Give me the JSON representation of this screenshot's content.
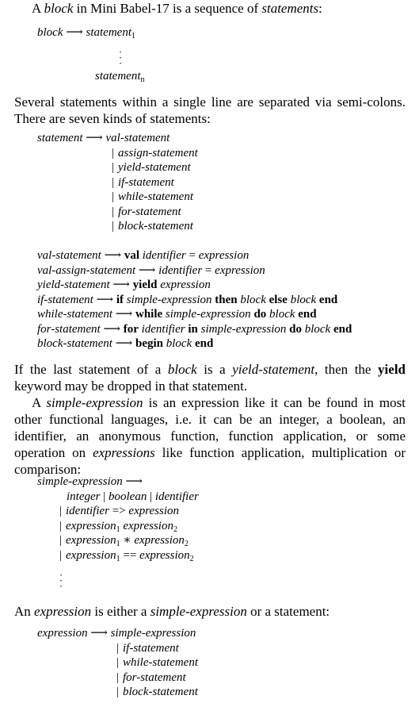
{
  "p1": {
    "a": "A ",
    "b": "block",
    "c": " in Mini Babel-17 is a sequence of ",
    "d": "statements",
    "e": ":"
  },
  "block_rule": {
    "lhs": "block",
    "arrow": "⟶",
    "first": "statement",
    "first_sub": "1",
    "last": "statement",
    "last_sub": "n"
  },
  "p2": "Several statements within a single line are separated via semi-colons. There are seven kinds of statements:",
  "stmt_rule": {
    "lhs": "statement",
    "arrow": "⟶",
    "alts": [
      "val-statement",
      "assign-statement",
      "yield-statement",
      "if-statement",
      "while-statement",
      "for-statement",
      "block-statement"
    ]
  },
  "rules": [
    {
      "n": "val-statement",
      "p": [
        {
          "t": "val",
          "s": "b"
        },
        {
          "t": " "
        },
        {
          "t": "identifier",
          "s": "i"
        },
        {
          "t": " = "
        },
        {
          "t": "expression",
          "s": "i"
        }
      ]
    },
    {
      "n": "val-assign-statement",
      "p": [
        {
          "t": "identifier",
          "s": "i"
        },
        {
          "t": " = "
        },
        {
          "t": "expression",
          "s": "i"
        }
      ]
    },
    {
      "n": "yield-statement",
      "p": [
        {
          "t": "yield",
          "s": "b"
        },
        {
          "t": " "
        },
        {
          "t": "expression",
          "s": "i"
        }
      ]
    },
    {
      "n": "if-statement",
      "p": [
        {
          "t": "if",
          "s": "b"
        },
        {
          "t": " "
        },
        {
          "t": "simple-expression",
          "s": "i"
        },
        {
          "t": " "
        },
        {
          "t": "then",
          "s": "b"
        },
        {
          "t": " "
        },
        {
          "t": "block",
          "s": "i"
        },
        {
          "t": " "
        },
        {
          "t": "else",
          "s": "b"
        },
        {
          "t": " "
        },
        {
          "t": "block",
          "s": "i"
        },
        {
          "t": " "
        },
        {
          "t": "end",
          "s": "b"
        }
      ]
    },
    {
      "n": "while-statement",
      "p": [
        {
          "t": "while",
          "s": "b"
        },
        {
          "t": " "
        },
        {
          "t": "simple-expression",
          "s": "i"
        },
        {
          "t": " "
        },
        {
          "t": "do",
          "s": "b"
        },
        {
          "t": " "
        },
        {
          "t": "block",
          "s": "i"
        },
        {
          "t": " "
        },
        {
          "t": "end",
          "s": "b"
        }
      ]
    },
    {
      "n": "for-statement",
      "p": [
        {
          "t": "for",
          "s": "b"
        },
        {
          "t": " "
        },
        {
          "t": "identifier",
          "s": "i"
        },
        {
          "t": " "
        },
        {
          "t": "in",
          "s": "b"
        },
        {
          "t": " "
        },
        {
          "t": "simple-expression",
          "s": "i"
        },
        {
          "t": " "
        },
        {
          "t": "do",
          "s": "b"
        },
        {
          "t": " "
        },
        {
          "t": "block",
          "s": "i"
        },
        {
          "t": " "
        },
        {
          "t": "end",
          "s": "b"
        }
      ]
    },
    {
      "n": "block-statement",
      "p": [
        {
          "t": "begin",
          "s": "b"
        },
        {
          "t": " "
        },
        {
          "t": "block",
          "s": "i"
        },
        {
          "t": " "
        },
        {
          "t": "end",
          "s": "b"
        }
      ]
    }
  ],
  "p3": [
    {
      "t": "If the last statement of a "
    },
    {
      "t": "block",
      "s": "i"
    },
    {
      "t": " is a "
    },
    {
      "t": "yield-statement",
      "s": "i"
    },
    {
      "t": ", then the "
    },
    {
      "t": "yield",
      "s": "b"
    },
    {
      "t": " keyword may be dropped in that statement."
    }
  ],
  "p4": [
    {
      "t": "A "
    },
    {
      "t": "simple-expression",
      "s": "i"
    },
    {
      "t": " is an expression like it can be found in most other functional languages, i.e. it can be an integer, a boolean, an identifier, an anonymous function, function application, or some operation on "
    },
    {
      "t": "expressions",
      "s": "i"
    },
    {
      "t": " like function application, multiplication or comparison:"
    }
  ],
  "se_rule": {
    "lhs": "simple-expression",
    "arrow": "⟶",
    "line1": [
      {
        "t": "integer",
        "s": "i"
      },
      {
        "t": " | "
      },
      {
        "t": "boolean",
        "s": "i"
      },
      {
        "t": " | "
      },
      {
        "t": "identifier",
        "s": "i"
      }
    ],
    "alts": [
      [
        {
          "t": "identifier",
          "s": "i"
        },
        {
          "t": " => "
        },
        {
          "t": "expression",
          "s": "i"
        }
      ],
      [
        {
          "t": "expression",
          "s": "i"
        },
        {
          "t": "1",
          "s": "sub"
        },
        {
          "t": " "
        },
        {
          "t": "expression",
          "s": "i"
        },
        {
          "t": "2",
          "s": "sub"
        }
      ],
      [
        {
          "t": "expression",
          "s": "i"
        },
        {
          "t": "1",
          "s": "sub"
        },
        {
          "t": " ∗ "
        },
        {
          "t": "expression",
          "s": "i"
        },
        {
          "t": "2",
          "s": "sub"
        }
      ],
      [
        {
          "t": "expression",
          "s": "i"
        },
        {
          "t": "1",
          "s": "sub"
        },
        {
          "t": " == "
        },
        {
          "t": "expression",
          "s": "i"
        },
        {
          "t": "2",
          "s": "sub"
        }
      ]
    ]
  },
  "p5": [
    {
      "t": "An "
    },
    {
      "t": "expression",
      "s": "i"
    },
    {
      "t": " is either a "
    },
    {
      "t": "simple-expression",
      "s": "i"
    },
    {
      "t": " or a statement:"
    }
  ],
  "expr_rule": {
    "lhs": "expression",
    "arrow": "⟶",
    "alts": [
      "simple-expression",
      "if-statement",
      "while-statement",
      "for-statement",
      "block-statement"
    ]
  }
}
